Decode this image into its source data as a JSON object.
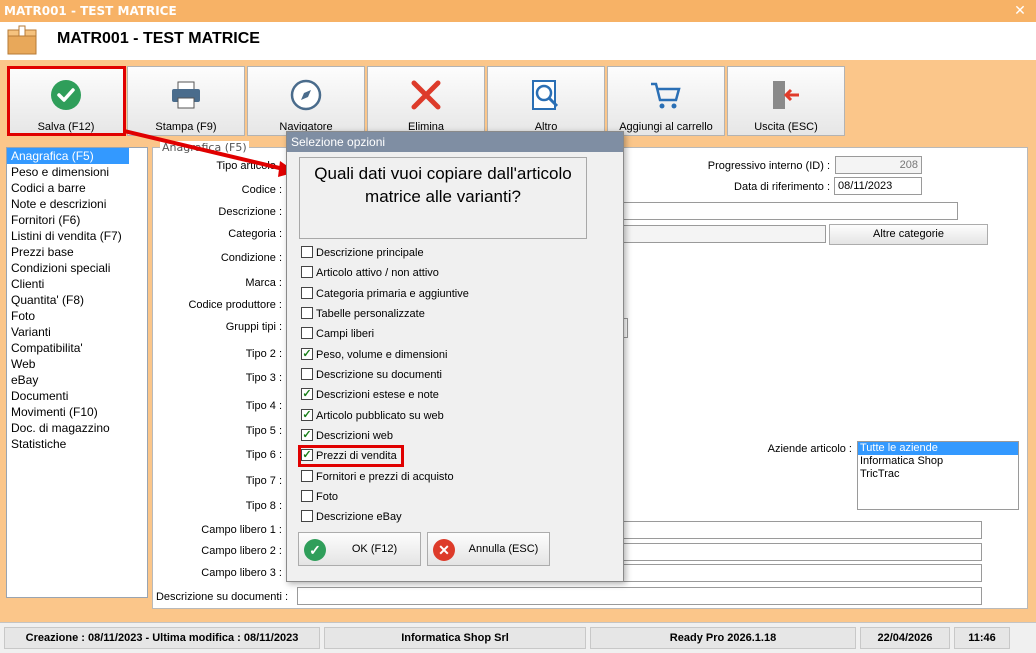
{
  "window": {
    "title": "MATR001 - TEST MATRICE",
    "close": "✕"
  },
  "header": {
    "title": "MATR001 - TEST MATRICE"
  },
  "toolbar": [
    {
      "name": "salva-button",
      "label": "Salva (F12)",
      "icon": "check-circle-icon"
    },
    {
      "name": "stampa-button",
      "label": "Stampa (F9)",
      "icon": "printer-icon"
    },
    {
      "name": "navigatore-button",
      "label": "Navigatore",
      "icon": "compass-icon"
    },
    {
      "name": "elimina-button",
      "label": "Elimina",
      "icon": "x-icon"
    },
    {
      "name": "altro-button",
      "label": "Altro",
      "icon": "search-document-icon"
    },
    {
      "name": "carrello-button",
      "label": "Aggiungi al carrello",
      "icon": "cart-icon"
    },
    {
      "name": "uscita-button",
      "label": "Uscita (ESC)",
      "icon": "exit-icon"
    }
  ],
  "nav": [
    "Anagrafica (F5)",
    "Peso e dimensioni",
    "Codici a barre",
    "Note e descrizioni",
    "Fornitori (F6)",
    "Listini di vendita (F7)",
    "Prezzi base",
    "Condizioni speciali",
    "Clienti",
    "Quantita' (F8)",
    "Foto",
    "Varianti",
    "Compatibilita'",
    "Web",
    "eBay",
    "Documenti",
    "Movimenti (F10)",
    "Doc. di magazzino",
    "Statistiche"
  ],
  "form": {
    "group": "Anagrafica (F5)",
    "labels": {
      "tipo_articolo": "Tipo articolo :",
      "codice": "Codice :",
      "descrizione": "Descrizione :",
      "categoria": "Categoria :",
      "condizione": "Condizione :",
      "marca": "Marca :",
      "codice_produttore": "Codice produttore :",
      "gruppi_tipi": "Gruppi tipi :",
      "tipo2": "Tipo 2 :",
      "tipo3": "Tipo 3 :",
      "tipo4": "Tipo 4 :",
      "tipo5": "Tipo 5 :",
      "tipo6": "Tipo 6 :",
      "tipo7": "Tipo 7 :",
      "tipo8": "Tipo 8 :",
      "campo1": "Campo libero 1 :",
      "campo2": "Campo libero 2 :",
      "campo3": "Campo libero 3 :",
      "desc_doc": "Descrizione su documenti :",
      "progressivo": "Progressivo interno (ID) :",
      "data_rif": "Data di riferimento :",
      "aziende": "Aziende articolo :"
    },
    "progressivo_value": "208",
    "data_rif_value": "08/11/2023",
    "altre_categorie": "Altre categorie",
    "aziende_list": [
      "Tutte le aziende",
      "Informatica Shop",
      "TricTrac"
    ]
  },
  "dialog": {
    "title": "Selezione opzioni",
    "question": "Quali dati vuoi copiare dall'articolo matrice alle varianti?",
    "options": [
      {
        "label": "Descrizione principale",
        "checked": false
      },
      {
        "label": "Articolo attivo / non attivo",
        "checked": false
      },
      {
        "label": "Categoria primaria e aggiuntive",
        "checked": false
      },
      {
        "label": "Tabelle personalizzate",
        "checked": false
      },
      {
        "label": "Campi liberi",
        "checked": false
      },
      {
        "label": "Peso, volume e dimensioni",
        "checked": true
      },
      {
        "label": "Descrizione su documenti",
        "checked": false
      },
      {
        "label": "Descrizioni estese e note",
        "checked": true
      },
      {
        "label": "Articolo pubblicato su web",
        "checked": true
      },
      {
        "label": "Descrizioni web",
        "checked": true
      },
      {
        "label": "Prezzi di vendita",
        "checked": true
      },
      {
        "label": "Fornitori e prezzi di acquisto",
        "checked": false
      },
      {
        "label": "Foto",
        "checked": false
      },
      {
        "label": "Descrizione eBay",
        "checked": false
      }
    ],
    "ok": "OK (F12)",
    "cancel": "Annulla (ESC)"
  },
  "status": {
    "dates": "Creazione : 08/11/2023 - Ultima modifica : 08/11/2023",
    "company": "Informatica Shop Srl",
    "version": "Ready Pro 2026.1.18",
    "date": "22/04/2026",
    "time": "11:46"
  },
  "colors": {
    "accent": "#fbc68a",
    "selection": "#3399ff",
    "highlight": "#e00000",
    "dialog_title": "#7f8ea3"
  }
}
